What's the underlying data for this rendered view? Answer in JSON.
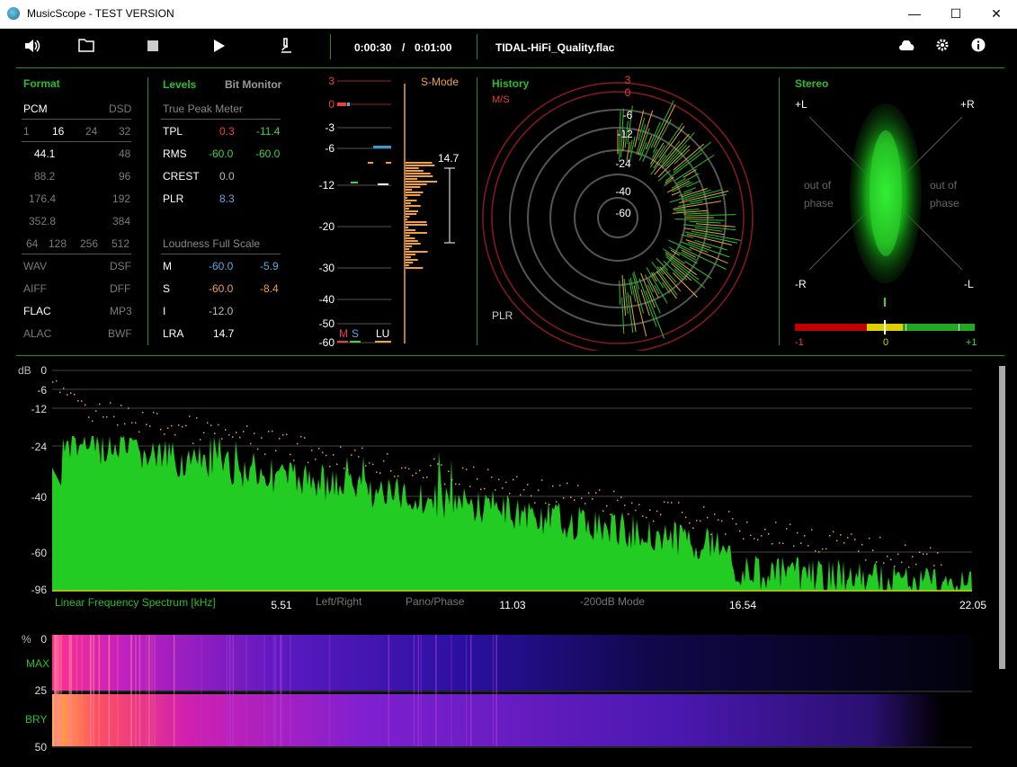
{
  "window": {
    "title": "MusicScope - TEST VERSION"
  },
  "toolbar": {
    "time_current": "0:00:30",
    "time_sep": "/",
    "time_total": "0:01:00",
    "filename": "TIDAL-HiFi_Quality.flac",
    "icons": [
      "speaker-icon",
      "folder-icon",
      "stop-icon",
      "play-icon",
      "microscope-icon",
      "cloud-icon",
      "gear-icon",
      "info-icon"
    ]
  },
  "format": {
    "title": "Format",
    "pcm": "PCM",
    "dsd": "DSD",
    "bitrates": [
      "1",
      "16",
      "24",
      "32"
    ],
    "rates_left": [
      "44.1",
      "88.2",
      "176.4",
      "352.8"
    ],
    "rates_right": [
      "48",
      "96",
      "192",
      "384"
    ],
    "dsd_rates": [
      "64",
      "128",
      "256",
      "512"
    ],
    "formats_left": [
      "WAV",
      "AIFF",
      "FLAC",
      "ALAC"
    ],
    "formats_right": [
      "DSF",
      "DFF",
      "MP3",
      "BWF"
    ]
  },
  "levels": {
    "title": "Levels",
    "bit_monitor": "Bit Monitor",
    "true_peak_title": "True Peak Meter",
    "rows": [
      {
        "label": "TPL",
        "v1": "0.3",
        "v2": "-11.4"
      },
      {
        "label": "RMS",
        "v1": "-60.0",
        "v2": "-60.0"
      },
      {
        "label": "CREST",
        "v1": "0.0",
        "v2": ""
      },
      {
        "label": "PLR",
        "v1": "8.3",
        "v2": ""
      }
    ],
    "loudness_title": "Loudness Full Scale",
    "loud_rows": [
      {
        "label": "M",
        "v1": "-60.0",
        "v2": "-5.9"
      },
      {
        "label": "S",
        "v1": "-60.0",
        "v2": "-8.4"
      },
      {
        "label": "I",
        "v1": "-12.0",
        "v2": ""
      },
      {
        "label": "LRA",
        "v1": "14.7",
        "v2": ""
      }
    ]
  },
  "meter": {
    "mode": "S-Mode",
    "scale": [
      "3",
      "0",
      "-3",
      "-6",
      "-12",
      "-20",
      "-30",
      "-40",
      "-50",
      "-60"
    ],
    "plr_value": "14.7",
    "legend_m": "M",
    "legend_s": "S",
    "legend_lu": "LU"
  },
  "history": {
    "title": "History",
    "sub": "M/S",
    "rings": [
      "3",
      "0",
      "-6",
      "-12",
      "-24",
      "-40",
      "-60"
    ],
    "plr_label": "PLR"
  },
  "stereo": {
    "title": "Stereo",
    "plus_l": "+L",
    "plus_r": "+R",
    "minus_r": "-R",
    "minus_l": "-L",
    "out_of_phase": "out of",
    "phase": "phase",
    "corr_min": "-1",
    "corr_mid": "0",
    "corr_max": "+1"
  },
  "spectrum": {
    "db_label": "dB",
    "db_ticks": [
      "0",
      "-6",
      "-12",
      "-24",
      "-40",
      "-60",
      "-96"
    ],
    "title": "Linear Frequency Spectrum [kHz]",
    "freq_ticks": [
      "5.51",
      "11.03",
      "16.54",
      "22.05"
    ],
    "modes": [
      "Left/Right",
      "Pano/Phase",
      "-200dB Mode"
    ]
  },
  "spectrogram": {
    "pct_label": "%",
    "ticks": [
      "0",
      "25",
      "50"
    ],
    "max_label": "MAX",
    "bry_label": "BRY"
  },
  "colors": {
    "accent_green": "#2bbf2b",
    "spectrum_green": "#22cc22",
    "peak_orange": "#f0a040",
    "red": "#e84040"
  }
}
